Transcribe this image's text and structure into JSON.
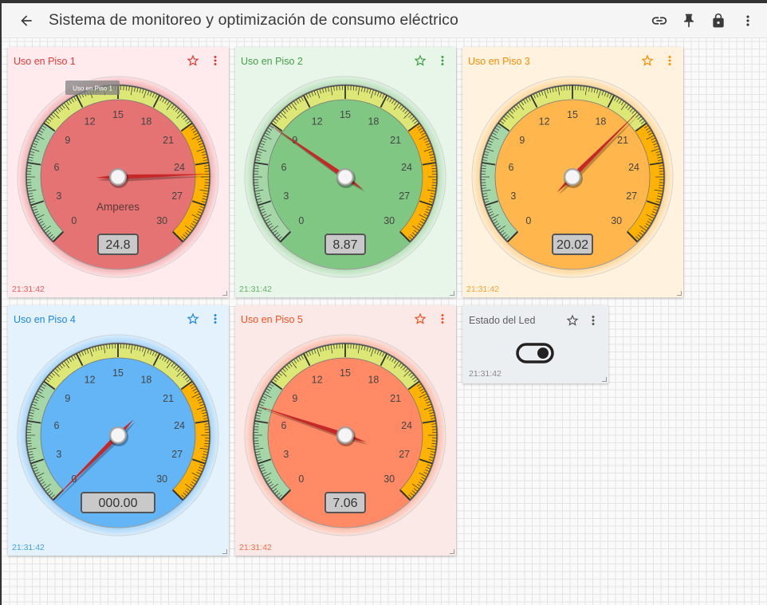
{
  "app": {
    "title": "Sistema de monitoreo y optimización de consumo eléctrico"
  },
  "appbar_icons": [
    "back-arrow-icon",
    "link-icon",
    "pin-icon",
    "lock-icon",
    "more-vert-icon"
  ],
  "gauge_scale": {
    "min": 0,
    "max": 30,
    "ticks": [
      "0",
      "3",
      "6",
      "9",
      "12",
      "15",
      "18",
      "21",
      "24",
      "27",
      "30"
    ],
    "unit_label": "Amperes"
  },
  "gauges": [
    {
      "title": "Uso en Piso 1",
      "value": 24.8,
      "display": "24.8",
      "time": "21:31:42",
      "tooltip": "Uso en Piso 1",
      "color": "#e53935",
      "face": "#e57373",
      "bg": "#ffebee"
    },
    {
      "title": "Uso en Piso 2",
      "value": 8.87,
      "display": "8.87",
      "time": "21:31:42",
      "color": "#43a047",
      "face": "#81c784",
      "bg": "#e8f5e9"
    },
    {
      "title": "Uso en Piso 3",
      "value": 20.02,
      "display": "20.02",
      "time": "21:31:42",
      "color": "#fb8c00",
      "face": "#ffb74d",
      "bg": "#fff3e0"
    },
    {
      "title": "Uso en Piso 4",
      "value": 0,
      "display": "000.00",
      "time": "21:31:42",
      "color": "#1e88e5",
      "face": "#64b5f6",
      "bg": "#e3f2fd"
    },
    {
      "title": "Uso en Piso 5",
      "value": 7.06,
      "display": "7.06",
      "time": "21:31:42",
      "color": "#f4511e",
      "face": "#ff8a65",
      "bg": "#fbe9e7"
    }
  ],
  "led": {
    "title": "Estado del Led",
    "time": "21:31:42",
    "state": "on",
    "color": "#616161",
    "bg": "#eceff1"
  }
}
